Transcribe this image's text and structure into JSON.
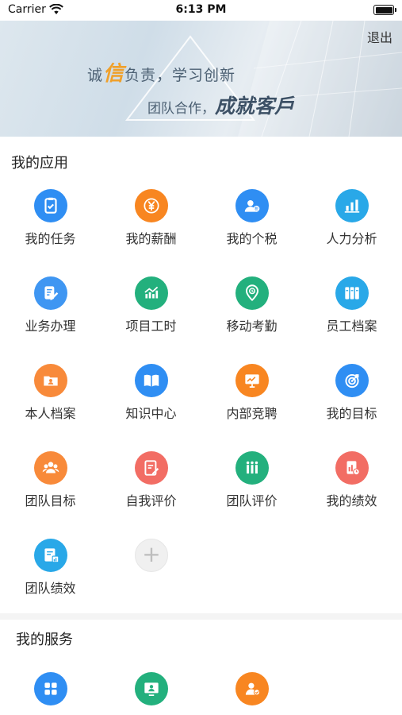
{
  "status_bar": {
    "carrier": "Carrier",
    "time": "6:13 PM"
  },
  "banner": {
    "slogan_line1_prefix": "诚",
    "slogan_line1_highlight": "信",
    "slogan_line1_suffix": "负责，学习创新",
    "slogan_line2_prefix": "团队合作，",
    "slogan_line2_big": "成就客戶",
    "logout_label": "退出"
  },
  "apps_section": {
    "title": "我的应用",
    "items": [
      {
        "label": "我的任务",
        "icon": "clipboard-check-icon",
        "color": "#2f8ef3"
      },
      {
        "label": "我的薪酬",
        "icon": "yuan-icon",
        "color": "#f88621"
      },
      {
        "label": "我的个税",
        "icon": "user-tax-icon",
        "color": "#2f8ef3"
      },
      {
        "label": "人力分析",
        "icon": "bar-chart-icon",
        "color": "#29a8e8"
      },
      {
        "label": "业务办理",
        "icon": "edit-document-icon",
        "color": "#3f96f2"
      },
      {
        "label": "项目工时",
        "icon": "growth-chart-icon",
        "color": "#23b07d"
      },
      {
        "label": "移动考勤",
        "icon": "location-clock-icon",
        "color": "#23b07d"
      },
      {
        "label": "员工档案",
        "icon": "binders-icon",
        "color": "#29a8e8"
      },
      {
        "label": "本人档案",
        "icon": "personal-folder-icon",
        "color": "#f88a3a"
      },
      {
        "label": "知识中心",
        "icon": "open-book-icon",
        "color": "#2f8ef3"
      },
      {
        "label": "内部竞聘",
        "icon": "presentation-board-icon",
        "color": "#f88621"
      },
      {
        "label": "我的目标",
        "icon": "target-icon",
        "color": "#2f8ef3"
      },
      {
        "label": "团队目标",
        "icon": "team-icon",
        "color": "#f88a3a"
      },
      {
        "label": "自我评价",
        "icon": "pen-note-icon",
        "color": "#f26d64"
      },
      {
        "label": "团队评价",
        "icon": "team-evaluation-icon",
        "color": "#23b07d"
      },
      {
        "label": "我的绩效",
        "icon": "performance-doc-icon",
        "color": "#f26d64"
      },
      {
        "label": "团队绩效",
        "icon": "team-performance-icon",
        "color": "#29a8e8"
      }
    ],
    "add_icon": "plus-icon"
  },
  "services_section": {
    "title": "我的服务",
    "items": [
      {
        "icon": "apps-grid-icon",
        "color": "#2f8ef3"
      },
      {
        "icon": "training-screen-icon",
        "color": "#23b07d"
      },
      {
        "icon": "user-service-icon",
        "color": "#f88621"
      }
    ]
  }
}
